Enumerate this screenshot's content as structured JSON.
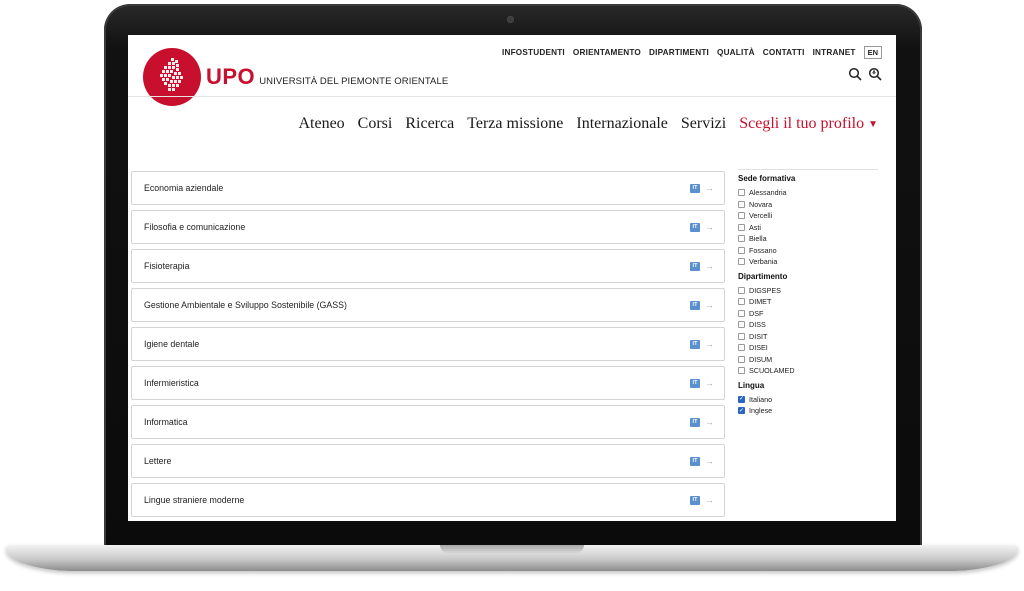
{
  "utility_nav": [
    "INFOSTUDENTI",
    "ORIENTAMENTO",
    "DIPARTIMENTI",
    "QUALITÀ",
    "CONTATTI",
    "INTRANET"
  ],
  "language_switch": "EN",
  "brand": {
    "short": "UPO",
    "name": "UNIVERSITÀ DEL PIEMONTE ORIENTALE",
    "accent_color": "#c8102e"
  },
  "header_icons": [
    "search-icon",
    "accessibility-zoom-icon"
  ],
  "main_nav": {
    "items": [
      "Ateneo",
      "Corsi",
      "Ricerca",
      "Terza missione",
      "Internazionale",
      "Servizi"
    ],
    "profile": "Scegli il tuo profilo",
    "profile_caret": "▼"
  },
  "courses": [
    {
      "name": "Economia aziendale",
      "lang": "IT"
    },
    {
      "name": "Filosofia e comunicazione",
      "lang": "IT"
    },
    {
      "name": "Fisioterapia",
      "lang": "IT"
    },
    {
      "name": "Gestione Ambientale e Sviluppo Sostenibile (GASS)",
      "lang": "IT"
    },
    {
      "name": "Igiene dentale",
      "lang": "IT"
    },
    {
      "name": "Infermieristica",
      "lang": "IT"
    },
    {
      "name": "Informatica",
      "lang": "IT"
    },
    {
      "name": "Lettere",
      "lang": "IT"
    },
    {
      "name": "Lingue straniere moderne",
      "lang": "IT"
    }
  ],
  "filters": [
    {
      "title": "Sede formativa",
      "options": [
        {
          "label": "Alessandria",
          "checked": false
        },
        {
          "label": "Novara",
          "checked": false
        },
        {
          "label": "Vercelli",
          "checked": false
        },
        {
          "label": "Asti",
          "checked": false
        },
        {
          "label": "Biella",
          "checked": false
        },
        {
          "label": "Fossano",
          "checked": false
        },
        {
          "label": "Verbania",
          "checked": false
        }
      ]
    },
    {
      "title": "Dipartimento",
      "options": [
        {
          "label": "DIGSPES",
          "checked": false
        },
        {
          "label": "DIMET",
          "checked": false
        },
        {
          "label": "DSF",
          "checked": false
        },
        {
          "label": "DISS",
          "checked": false
        },
        {
          "label": "DISIT",
          "checked": false
        },
        {
          "label": "DISEI",
          "checked": false
        },
        {
          "label": "DISUM",
          "checked": false
        },
        {
          "label": "SCUOLAMED",
          "checked": false
        }
      ]
    },
    {
      "title": "Lingua",
      "options": [
        {
          "label": "Italiano",
          "checked": true
        },
        {
          "label": "Inglese",
          "checked": true
        }
      ]
    }
  ],
  "colors": {
    "checkbox_checked": "#2b66c4",
    "lang_badge": "#5a8fd0"
  }
}
